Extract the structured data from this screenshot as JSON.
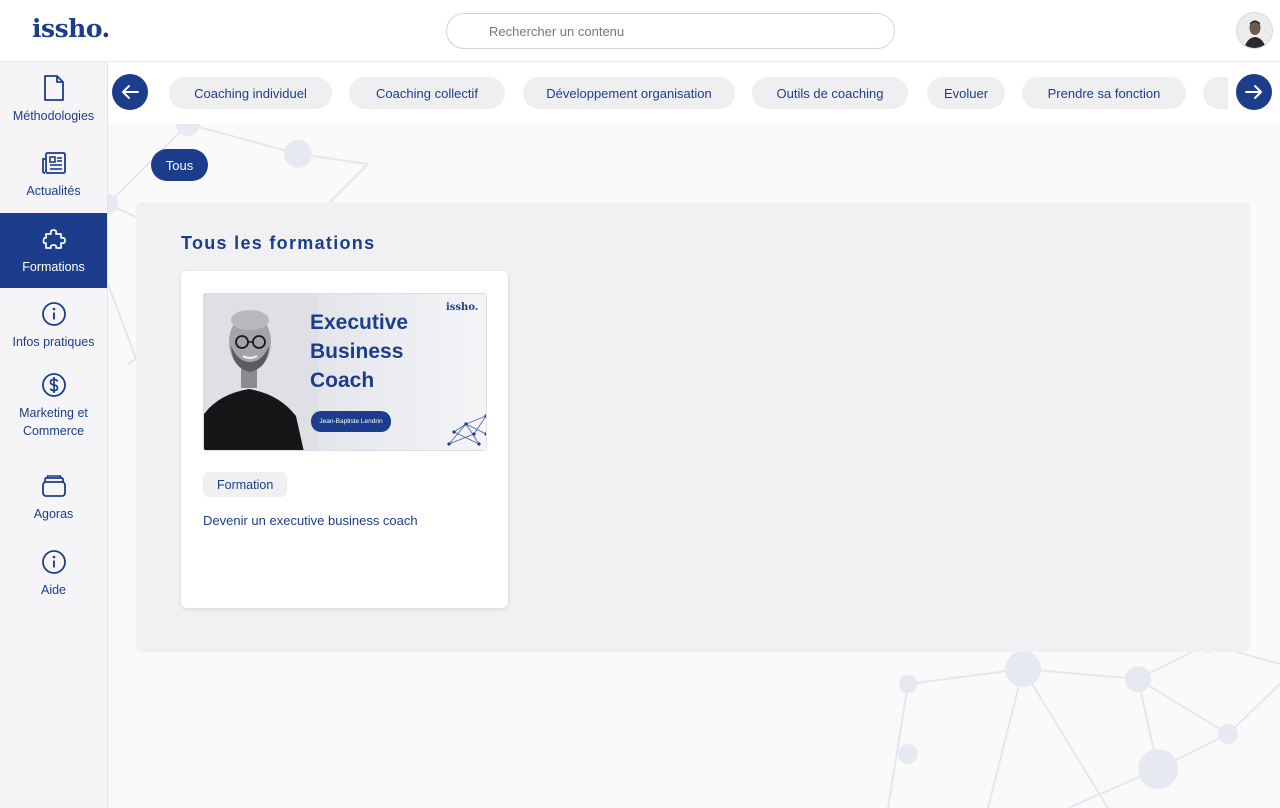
{
  "header": {
    "logo": "issho.",
    "search_placeholder": "Rechercher un contenu"
  },
  "sidebar": {
    "items": [
      {
        "label": "Méthodologies",
        "icon": "document-icon"
      },
      {
        "label": "Actualités",
        "icon": "newspaper-icon"
      },
      {
        "label": "Formations",
        "icon": "puzzle-icon",
        "active": true
      },
      {
        "label": "Infos pratiques",
        "icon": "info-icon"
      },
      {
        "label": "Marketing et Commerce",
        "icon": "dollar-icon"
      },
      {
        "label": "Agoras",
        "icon": "folder-stack-icon"
      },
      {
        "label": "Aide",
        "icon": "info-icon"
      }
    ]
  },
  "categories": [
    "Coaching individuel",
    "Coaching collectif",
    "Développement organisation",
    "Outils de coaching",
    "Evoluer",
    "Prendre sa fonction"
  ],
  "filter": {
    "active_label": "Tous"
  },
  "section": {
    "title": "Tous les formations"
  },
  "cards": [
    {
      "thumbnail": {
        "title_line1": "Executive",
        "title_line2": "Business",
        "title_line3": "Coach",
        "person_name": "Jean-Baptiste Lendrin",
        "logo": "issho."
      },
      "badge": "Formation",
      "title": "Devenir un executive business coach"
    }
  ],
  "colors": {
    "brand": "#1c3d8c",
    "chip_bg": "#efeff2",
    "sidebar_bg": "#f5f5f7"
  }
}
